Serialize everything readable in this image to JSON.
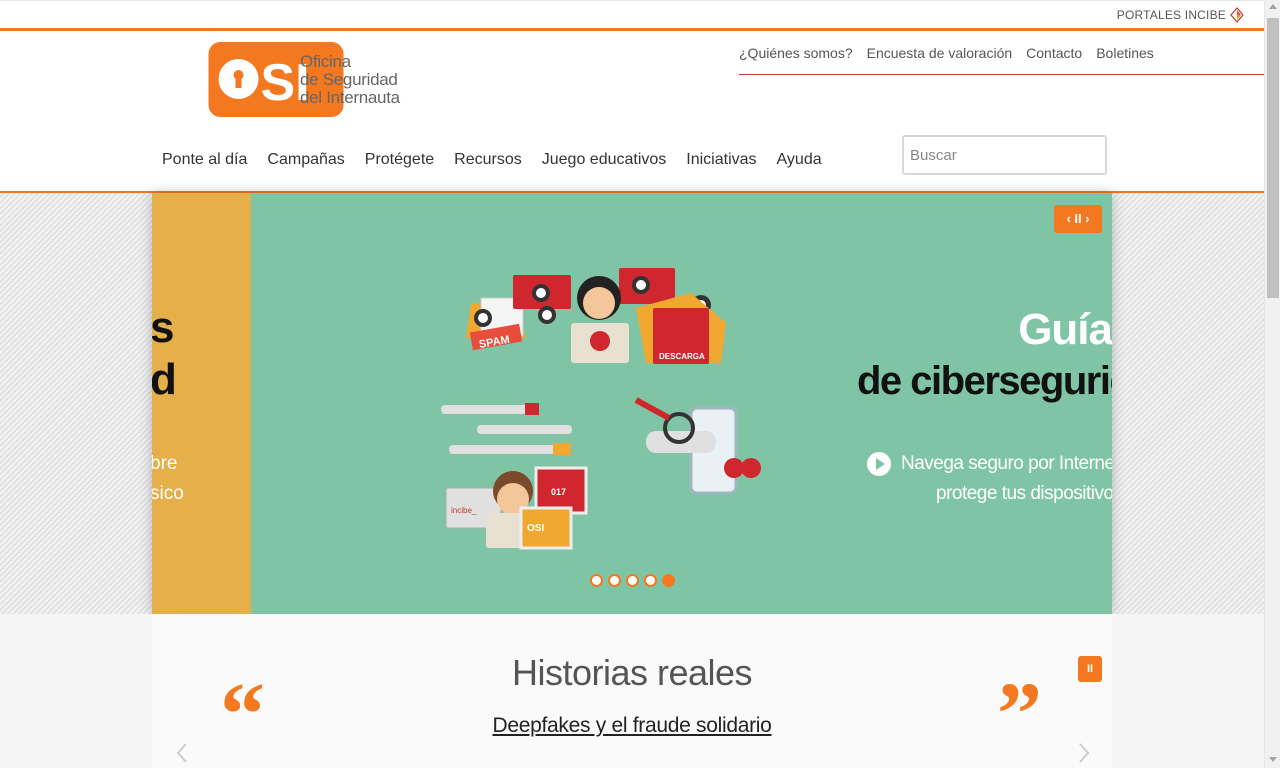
{
  "top_bar": {
    "portales_label": "PORTALES INCIBE"
  },
  "logo": {
    "brand": "OSI",
    "line1": "Oficina",
    "line2": "de Seguridad",
    "line3": "del Internauta"
  },
  "utility_nav": [
    "¿Quiénes somos?",
    "Encuesta de valoración",
    "Contacto",
    "Boletines"
  ],
  "main_nav": [
    "Ponte al día",
    "Campañas",
    "Protégete",
    "Recursos",
    "Juego educativos",
    "Iniciativas",
    "Ayuda"
  ],
  "search": {
    "placeholder": "Buscar",
    "value": ""
  },
  "slider": {
    "control_label": "‹ II ›",
    "prev_slide": {
      "big1": "s",
      "big2": "d",
      "small1": "bre",
      "small2": "sico",
      "color": "#e5b04a"
    },
    "current_slide": {
      "title1": "Guía",
      "title2": "de ciberseguridad",
      "sub1": "Navega seguro por Internet y",
      "sub2": "protege tus dispositivos",
      "color": "#7fc5a5",
      "illustration_labels": [
        "SPAM",
        "DESCARGA",
        "incibe_",
        "017",
        "OSI"
      ]
    },
    "dots_count": 5,
    "active_dot": 5
  },
  "historias": {
    "title": "Historias reales",
    "link": "Deepfakes y el fraude solidario",
    "quote_open": "“",
    "quote_close": "”",
    "pause_label": "II"
  },
  "colors": {
    "accent": "#f47820",
    "red_line": "#c0392b"
  }
}
